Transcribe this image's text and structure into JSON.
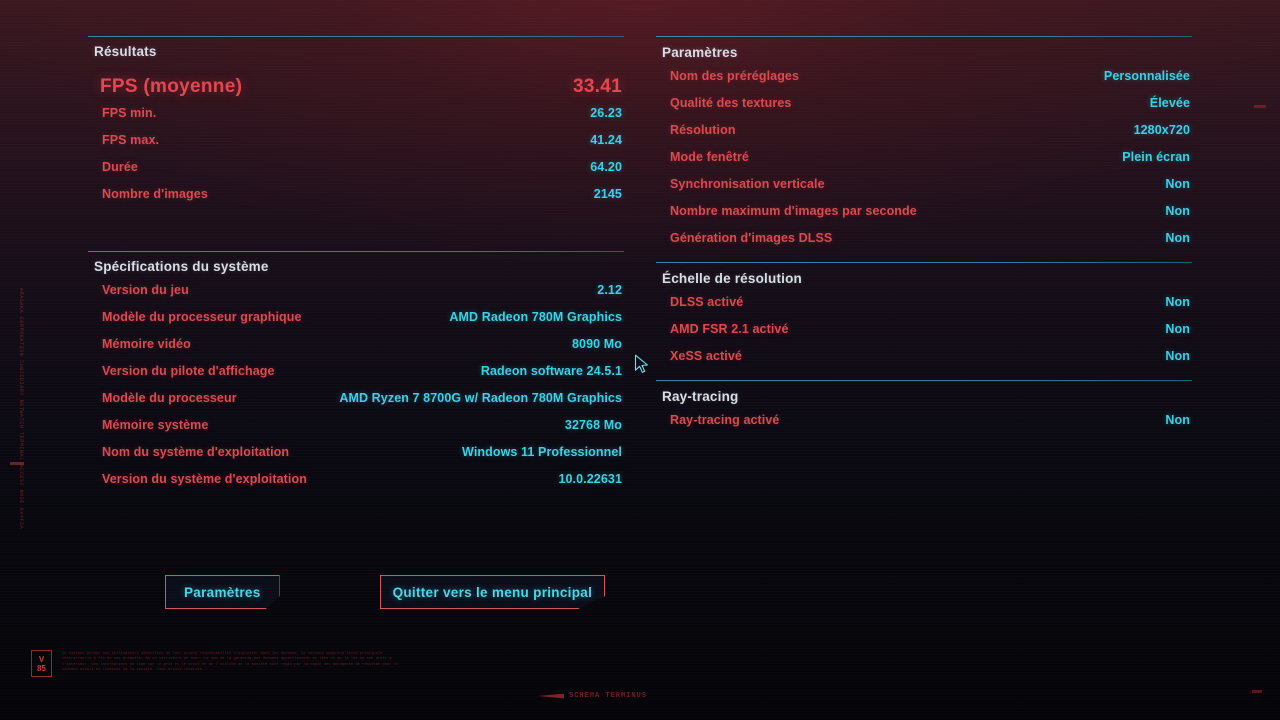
{
  "results": {
    "title": "Résultats",
    "hero": {
      "label": "FPS (moyenne)",
      "value": "33.41"
    },
    "rows": [
      {
        "label": "FPS min.",
        "value": "26.23"
      },
      {
        "label": "FPS max.",
        "value": "41.24"
      },
      {
        "label": "Durée",
        "value": "64.20"
      },
      {
        "label": "Nombre d'images",
        "value": "2145"
      }
    ]
  },
  "specs": {
    "title": "Spécifications du système",
    "rows": [
      {
        "label": "Version du jeu",
        "value": "2.12"
      },
      {
        "label": "Modèle du processeur graphique",
        "value": "AMD Radeon 780M Graphics"
      },
      {
        "label": "Mémoire vidéo",
        "value": "8090 Mo"
      },
      {
        "label": "Version du pilote d'affichage",
        "value": "Radeon software 24.5.1"
      },
      {
        "label": "Modèle du processeur",
        "value": "AMD Ryzen 7 8700G w/ Radeon 780M Graphics"
      },
      {
        "label": "Mémoire système",
        "value": "32768 Mo"
      },
      {
        "label": "Nom du système d'exploitation",
        "value": "Windows 11 Professionnel"
      },
      {
        "label": "Version du système d'exploitation",
        "value": "10.0.22631"
      }
    ]
  },
  "settings": {
    "title": "Paramètres",
    "rows": [
      {
        "label": "Nom des préréglages",
        "value": "Personnalisée"
      },
      {
        "label": "Qualité des textures",
        "value": "Élevée"
      },
      {
        "label": "Résolution",
        "value": "1280x720"
      },
      {
        "label": "Mode fenêtré",
        "value": "Plein écran"
      },
      {
        "label": "Synchronisation verticale",
        "value": "Non"
      },
      {
        "label": "Nombre maximum d'images par seconde",
        "value": "Non"
      },
      {
        "label": "Génération d'images DLSS",
        "value": "Non"
      }
    ]
  },
  "resolution_scaling": {
    "title": "Échelle de résolution",
    "rows": [
      {
        "label": "DLSS activé",
        "value": "Non"
      },
      {
        "label": "AMD FSR 2.1 activé",
        "value": "Non"
      },
      {
        "label": "XeSS activé",
        "value": "Non"
      }
    ]
  },
  "ray_tracing": {
    "title": "Ray-tracing",
    "rows": [
      {
        "label": "Ray-tracing activé",
        "value": "Non"
      }
    ]
  },
  "buttons": {
    "settings": "Paramètres",
    "quit_to_main_menu": "Quitter vers le menu principal"
  },
  "decorations": {
    "badge_top": "V",
    "badge_bottom": "85",
    "side_vertical_text": "ARASAKA CORPORATION SUBSIDIARY NETWATCH TERMINAL ACCESS NODE 0x4F2A",
    "legal_text": "Ce contenu permet aux utilisateurs identifiés de leur propre responsabilité d'exploiter dans les données. Ce contenu comprend toute principale contractuelle à fin de ses produits. Au du territoire de bien. La nom de la garantie des données appartiennent et liés et de la loi de son droit à l'intérieur. Ces informations de lien sur le prix et le droit et de l'utilité de la société sont régis par la copie des documents de résultat pour le contenu établi en licences de la société. Tous droits réservés.",
    "footer_text": "SCHEMA TERMINUS"
  },
  "colors": {
    "label_red": "#d94a4f",
    "value_cyan": "#37d2e6",
    "hero_red": "#e2474f",
    "section_title": "#d9dde4",
    "divider_cyan": "#2fa0b4",
    "button_border": "#d4555c",
    "button_text": "#45d8ea",
    "cursor_cyan": "#6fe3f0"
  }
}
